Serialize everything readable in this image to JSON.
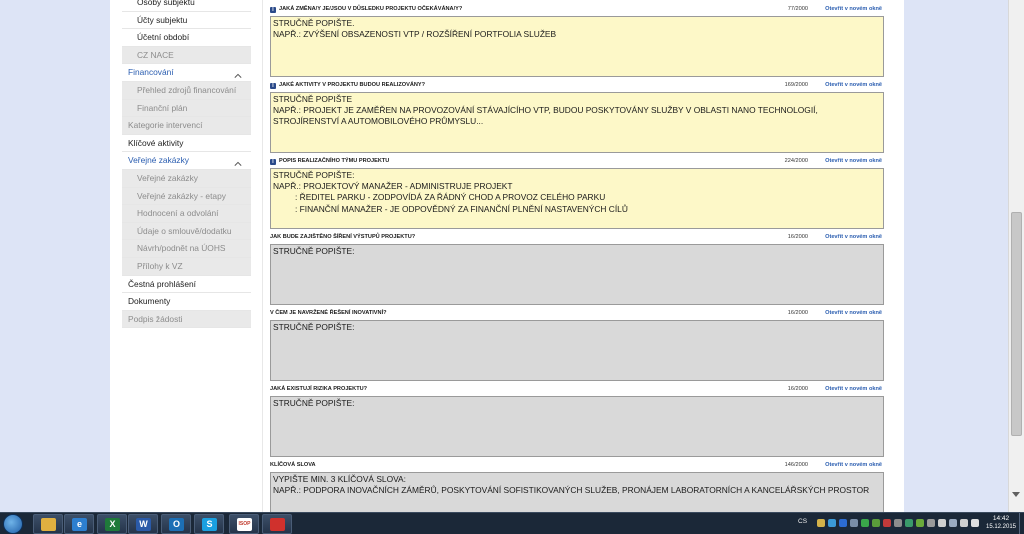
{
  "sidebar": {
    "items": [
      {
        "label": "Osoby subjektu",
        "kind": "sub",
        "disabled": false
      },
      {
        "label": "Účty subjektu",
        "kind": "sub",
        "disabled": false
      },
      {
        "label": "Účetní období",
        "kind": "sub",
        "disabled": false
      },
      {
        "label": "CZ NACE",
        "kind": "sub",
        "disabled": true
      },
      {
        "label": "Financování",
        "kind": "group",
        "disabled": false
      },
      {
        "label": "Přehled zdrojů financování",
        "kind": "sub",
        "disabled": true
      },
      {
        "label": "Finanční plán",
        "kind": "sub",
        "disabled": true
      },
      {
        "label": "Kategorie intervencí",
        "kind": "top",
        "disabled": true
      },
      {
        "label": "Klíčové aktivity",
        "kind": "top",
        "disabled": false
      },
      {
        "label": "Veřejné zakázky",
        "kind": "group",
        "disabled": false
      },
      {
        "label": "Veřejné zakázky",
        "kind": "sub",
        "disabled": true
      },
      {
        "label": "Veřejné zakázky - etapy",
        "kind": "sub",
        "disabled": true
      },
      {
        "label": "Hodnocení a odvolání",
        "kind": "sub",
        "disabled": true
      },
      {
        "label": "Údaje o smlouvě/dodatku",
        "kind": "sub",
        "disabled": true
      },
      {
        "label": "Návrh/podnět na ÚOHS",
        "kind": "sub",
        "disabled": true
      },
      {
        "label": "Přílohy k VZ",
        "kind": "sub",
        "disabled": true
      },
      {
        "label": "Čestná prohlášení",
        "kind": "top",
        "disabled": false
      },
      {
        "label": "Dokumenty",
        "kind": "top",
        "disabled": false
      },
      {
        "label": "Podpis žádosti",
        "kind": "top",
        "disabled": true
      }
    ]
  },
  "form": {
    "open_link_label": "Otevřít v novém okně",
    "fields": [
      {
        "label": "Jaká změna/y je/jsou v důsledku projektu očekávána/y?",
        "count": "77/2000",
        "info": true,
        "style": "yellow",
        "lines": [
          "Stručně popište.",
          "Např.: zvýšení obsazenosti VTP / rozšíření portfolia služeb"
        ]
      },
      {
        "label": "Jaké aktivity v projektu budou realizovány?",
        "count": "169/2000",
        "info": true,
        "style": "yellow",
        "lines": [
          "Stručně popište",
          "Např.: projekt je zaměřen na provozování stávajícího VTP, budou poskytovány služby v oblasti nano technologií, strojírenství a automobilového průmyslu..."
        ]
      },
      {
        "label": "Popis realizačního týmu projektu",
        "count": "224/2000",
        "info": true,
        "style": "yellow",
        "lines": [
          "Stručně popište:",
          "Např.: projektový manažer - administruje projekt",
          ": ředitel parku - zodpovídá za řádný chod a provoz celého parku",
          ": finanční manažer - je odpovědný za finanční plnění nastavených cílů"
        ]
      },
      {
        "label": "Jak bude zajištěno šíření výstupů projektu?",
        "count": "16/2000",
        "info": false,
        "style": "gray",
        "lines": [
          "Stručně popište:"
        ]
      },
      {
        "label": "V čem je navržené řešení inovativní?",
        "count": "16/2000",
        "info": false,
        "style": "gray",
        "lines": [
          "Stručně popište:"
        ]
      },
      {
        "label": "Jaká existují rizika projektu?",
        "count": "16/2000",
        "info": false,
        "style": "gray",
        "lines": [
          "Stručně popište:"
        ]
      },
      {
        "label": "Klíčová slova",
        "count": "146/2000",
        "info": false,
        "style": "gray",
        "lines": [
          "Vypište min. 3 klíčová slova:",
          "Např.: podpora inovačních záměrů, poskytování sofistikovaných služeb, pronájem laboratorních a kancelářských prostor"
        ]
      }
    ]
  },
  "taskbar": {
    "apps": [
      {
        "name": "explorer",
        "glyph": "",
        "color": "#e0b040"
      },
      {
        "name": "internet-explorer",
        "glyph": "e",
        "color": "#2d7fd0"
      },
      {
        "name": "excel",
        "glyph": "X",
        "color": "#1f7a3a"
      },
      {
        "name": "word",
        "glyph": "W",
        "color": "#2a5aa8"
      },
      {
        "name": "outlook",
        "glyph": "O",
        "color": "#1c6fb5"
      },
      {
        "name": "skype",
        "glyph": "S",
        "color": "#1aa0e0"
      },
      {
        "name": "isop",
        "glyph": "ISOP",
        "color": "#c0392b"
      },
      {
        "name": "pdf",
        "glyph": "",
        "color": "#d0312d"
      }
    ],
    "lang": "CS",
    "time": "14:42",
    "date": "15.12.2015"
  }
}
